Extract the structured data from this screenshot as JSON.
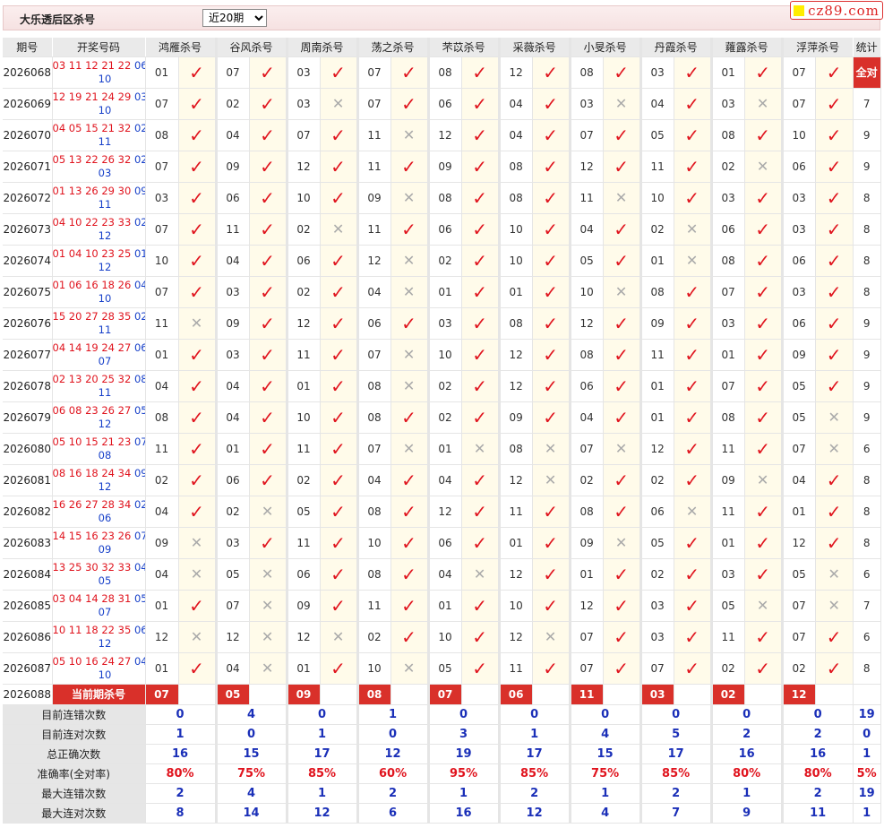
{
  "header": {
    "title": "大乐透后区杀号",
    "range_selected": "近20期",
    "logo_text": "cz89.com"
  },
  "columns": {
    "period": "期号",
    "draw": "开奖号码",
    "experts": [
      "鸿雁杀号",
      "谷风杀号",
      "周南杀号",
      "荡之杀号",
      "芣苡杀号",
      "采薇杀号",
      "小旻杀号",
      "丹霞杀号",
      "蕹露杀号",
      "浮萍杀号"
    ],
    "stat": "统计"
  },
  "rows": [
    {
      "period": "2026068",
      "front": "03 11 12 21 22",
      "back1": "06",
      "back2": "10",
      "kills": [
        "01",
        "07",
        "03",
        "07",
        "08",
        "12",
        "08",
        "03",
        "01",
        "07"
      ],
      "marks": [
        1,
        1,
        1,
        1,
        1,
        1,
        1,
        1,
        1,
        1
      ],
      "stat": "全对"
    },
    {
      "period": "2026069",
      "front": "12 19 21 24 29",
      "back1": "03",
      "back2": "10",
      "kills": [
        "07",
        "02",
        "03",
        "07",
        "06",
        "04",
        "03",
        "04",
        "03",
        "07"
      ],
      "marks": [
        1,
        1,
        0,
        1,
        1,
        1,
        0,
        1,
        0,
        1
      ],
      "stat": "7"
    },
    {
      "period": "2026070",
      "front": "04 05 15 21 32",
      "back1": "02",
      "back2": "11",
      "kills": [
        "08",
        "04",
        "07",
        "11",
        "12",
        "04",
        "07",
        "05",
        "08",
        "10"
      ],
      "marks": [
        1,
        1,
        1,
        0,
        1,
        1,
        1,
        1,
        1,
        1
      ],
      "stat": "9"
    },
    {
      "period": "2026071",
      "front": "05 13 22 26 32",
      "back1": "02",
      "back2": "03",
      "kills": [
        "07",
        "09",
        "12",
        "11",
        "09",
        "08",
        "12",
        "11",
        "02",
        "06"
      ],
      "marks": [
        1,
        1,
        1,
        1,
        1,
        1,
        1,
        1,
        0,
        1
      ],
      "stat": "9"
    },
    {
      "period": "2026072",
      "front": "01 13 26 29 30",
      "back1": "09",
      "back2": "11",
      "kills": [
        "03",
        "06",
        "10",
        "09",
        "08",
        "08",
        "11",
        "10",
        "03",
        "03"
      ],
      "marks": [
        1,
        1,
        1,
        0,
        1,
        1,
        0,
        1,
        1,
        1
      ],
      "stat": "8"
    },
    {
      "period": "2026073",
      "front": "04 10 22 23 33",
      "back1": "02",
      "back2": "12",
      "kills": [
        "07",
        "11",
        "02",
        "11",
        "06",
        "10",
        "04",
        "02",
        "06",
        "03"
      ],
      "marks": [
        1,
        1,
        0,
        1,
        1,
        1,
        1,
        0,
        1,
        1
      ],
      "stat": "8"
    },
    {
      "period": "2026074",
      "front": "01 04 10 23 25",
      "back1": "01",
      "back2": "12",
      "kills": [
        "10",
        "04",
        "06",
        "12",
        "02",
        "10",
        "05",
        "01",
        "08",
        "06"
      ],
      "marks": [
        1,
        1,
        1,
        0,
        1,
        1,
        1,
        0,
        1,
        1
      ],
      "stat": "8"
    },
    {
      "period": "2026075",
      "front": "01 06 16 18 26",
      "back1": "04",
      "back2": "10",
      "kills": [
        "07",
        "03",
        "02",
        "04",
        "01",
        "01",
        "10",
        "08",
        "07",
        "03"
      ],
      "marks": [
        1,
        1,
        1,
        0,
        1,
        1,
        0,
        1,
        1,
        1
      ],
      "stat": "8"
    },
    {
      "period": "2026076",
      "front": "15 20 27 28 35",
      "back1": "02",
      "back2": "11",
      "kills": [
        "11",
        "09",
        "12",
        "06",
        "03",
        "08",
        "12",
        "09",
        "03",
        "06"
      ],
      "marks": [
        0,
        1,
        1,
        1,
        1,
        1,
        1,
        1,
        1,
        1
      ],
      "stat": "9"
    },
    {
      "period": "2026077",
      "front": "04 14 19 24 27",
      "back1": "06",
      "back2": "07",
      "kills": [
        "01",
        "03",
        "11",
        "07",
        "10",
        "12",
        "08",
        "11",
        "01",
        "09"
      ],
      "marks": [
        1,
        1,
        1,
        0,
        1,
        1,
        1,
        1,
        1,
        1
      ],
      "stat": "9"
    },
    {
      "period": "2026078",
      "front": "02 13 20 25 32",
      "back1": "08",
      "back2": "11",
      "kills": [
        "04",
        "04",
        "01",
        "08",
        "02",
        "12",
        "06",
        "01",
        "07",
        "05"
      ],
      "marks": [
        1,
        1,
        1,
        0,
        1,
        1,
        1,
        1,
        1,
        1
      ],
      "stat": "9"
    },
    {
      "period": "2026079",
      "front": "06 08 23 26 27",
      "back1": "05",
      "back2": "12",
      "kills": [
        "08",
        "04",
        "10",
        "08",
        "02",
        "09",
        "04",
        "01",
        "08",
        "05"
      ],
      "marks": [
        1,
        1,
        1,
        1,
        1,
        1,
        1,
        1,
        1,
        0
      ],
      "stat": "9"
    },
    {
      "period": "2026080",
      "front": "05 10 15 21 23",
      "back1": "07",
      "back2": "08",
      "kills": [
        "11",
        "01",
        "11",
        "07",
        "01",
        "08",
        "07",
        "12",
        "11",
        "07"
      ],
      "marks": [
        1,
        1,
        1,
        0,
        0,
        0,
        0,
        1,
        1,
        0
      ],
      "stat": "6"
    },
    {
      "period": "2026081",
      "front": "08 16 18 24 34",
      "back1": "09",
      "back2": "12",
      "kills": [
        "02",
        "06",
        "02",
        "04",
        "04",
        "12",
        "02",
        "02",
        "09",
        "04"
      ],
      "marks": [
        1,
        1,
        1,
        1,
        1,
        0,
        1,
        1,
        0,
        1
      ],
      "stat": "8"
    },
    {
      "period": "2026082",
      "front": "16 26 27 28 34",
      "back1": "02",
      "back2": "06",
      "kills": [
        "04",
        "02",
        "05",
        "08",
        "12",
        "11",
        "08",
        "06",
        "11",
        "01"
      ],
      "marks": [
        1,
        0,
        1,
        1,
        1,
        1,
        1,
        0,
        1,
        1
      ],
      "stat": "8"
    },
    {
      "period": "2026083",
      "front": "14 15 16 23 26",
      "back1": "07",
      "back2": "09",
      "kills": [
        "09",
        "03",
        "11",
        "10",
        "06",
        "01",
        "09",
        "05",
        "01",
        "12"
      ],
      "marks": [
        0,
        1,
        1,
        1,
        1,
        1,
        0,
        1,
        1,
        1
      ],
      "stat": "8"
    },
    {
      "period": "2026084",
      "front": "13 25 30 32 33",
      "back1": "04",
      "back2": "05",
      "kills": [
        "04",
        "05",
        "06",
        "08",
        "04",
        "12",
        "01",
        "02",
        "03",
        "05"
      ],
      "marks": [
        0,
        0,
        1,
        1,
        0,
        1,
        1,
        1,
        1,
        0
      ],
      "stat": "6"
    },
    {
      "period": "2026085",
      "front": "03 04 14 28 31",
      "back1": "05",
      "back2": "07",
      "kills": [
        "01",
        "07",
        "09",
        "11",
        "01",
        "10",
        "12",
        "03",
        "05",
        "07"
      ],
      "marks": [
        1,
        0,
        1,
        1,
        1,
        1,
        1,
        1,
        0,
        0
      ],
      "stat": "7"
    },
    {
      "period": "2026086",
      "front": "10 11 18 22 35",
      "back1": "06",
      "back2": "12",
      "kills": [
        "12",
        "12",
        "12",
        "02",
        "10",
        "12",
        "07",
        "03",
        "11",
        "07"
      ],
      "marks": [
        0,
        0,
        0,
        1,
        1,
        0,
        1,
        1,
        1,
        1
      ],
      "stat": "6"
    },
    {
      "period": "2026087",
      "front": "05 10 16 24 27",
      "back1": "04",
      "back2": "10",
      "kills": [
        "01",
        "04",
        "01",
        "10",
        "05",
        "11",
        "07",
        "07",
        "02",
        "02"
      ],
      "marks": [
        1,
        0,
        1,
        0,
        1,
        1,
        1,
        1,
        1,
        1
      ],
      "stat": "8"
    }
  ],
  "current": {
    "period": "2026088",
    "label": "当前期杀号",
    "kills": [
      "07",
      "05",
      "09",
      "08",
      "07",
      "06",
      "11",
      "03",
      "02",
      "12"
    ]
  },
  "stats": [
    {
      "label": "目前连错次数",
      "values": [
        "0",
        "4",
        "0",
        "1",
        "0",
        "0",
        "0",
        "0",
        "0",
        "0"
      ],
      "total": "19",
      "red": false
    },
    {
      "label": "目前连对次数",
      "values": [
        "1",
        "0",
        "1",
        "0",
        "3",
        "1",
        "4",
        "5",
        "2",
        "2"
      ],
      "total": "0",
      "red": false
    },
    {
      "label": "总正确次数",
      "values": [
        "16",
        "15",
        "17",
        "12",
        "19",
        "17",
        "15",
        "17",
        "16",
        "16"
      ],
      "total": "1",
      "red": false
    },
    {
      "label": "准确率(全对率)",
      "values": [
        "80%",
        "75%",
        "85%",
        "60%",
        "95%",
        "85%",
        "75%",
        "85%",
        "80%",
        "80%"
      ],
      "total": "5%",
      "red": true
    },
    {
      "label": "最大连错次数",
      "values": [
        "2",
        "4",
        "1",
        "2",
        "1",
        "2",
        "1",
        "2",
        "1",
        "2"
      ],
      "total": "19",
      "red": false
    },
    {
      "label": "最大连对次数",
      "values": [
        "8",
        "14",
        "12",
        "6",
        "16",
        "12",
        "4",
        "7",
        "9",
        "11"
      ],
      "total": "1",
      "red": false
    }
  ],
  "symbols": {
    "ok": "✓",
    "no": "✕"
  },
  "colors": {
    "accent_red": "#d9302a",
    "front_red": "#e0141e",
    "back_blue": "#1740c9",
    "stat_blue": "#1a2fb8",
    "mark_bg": "#fffbea"
  }
}
